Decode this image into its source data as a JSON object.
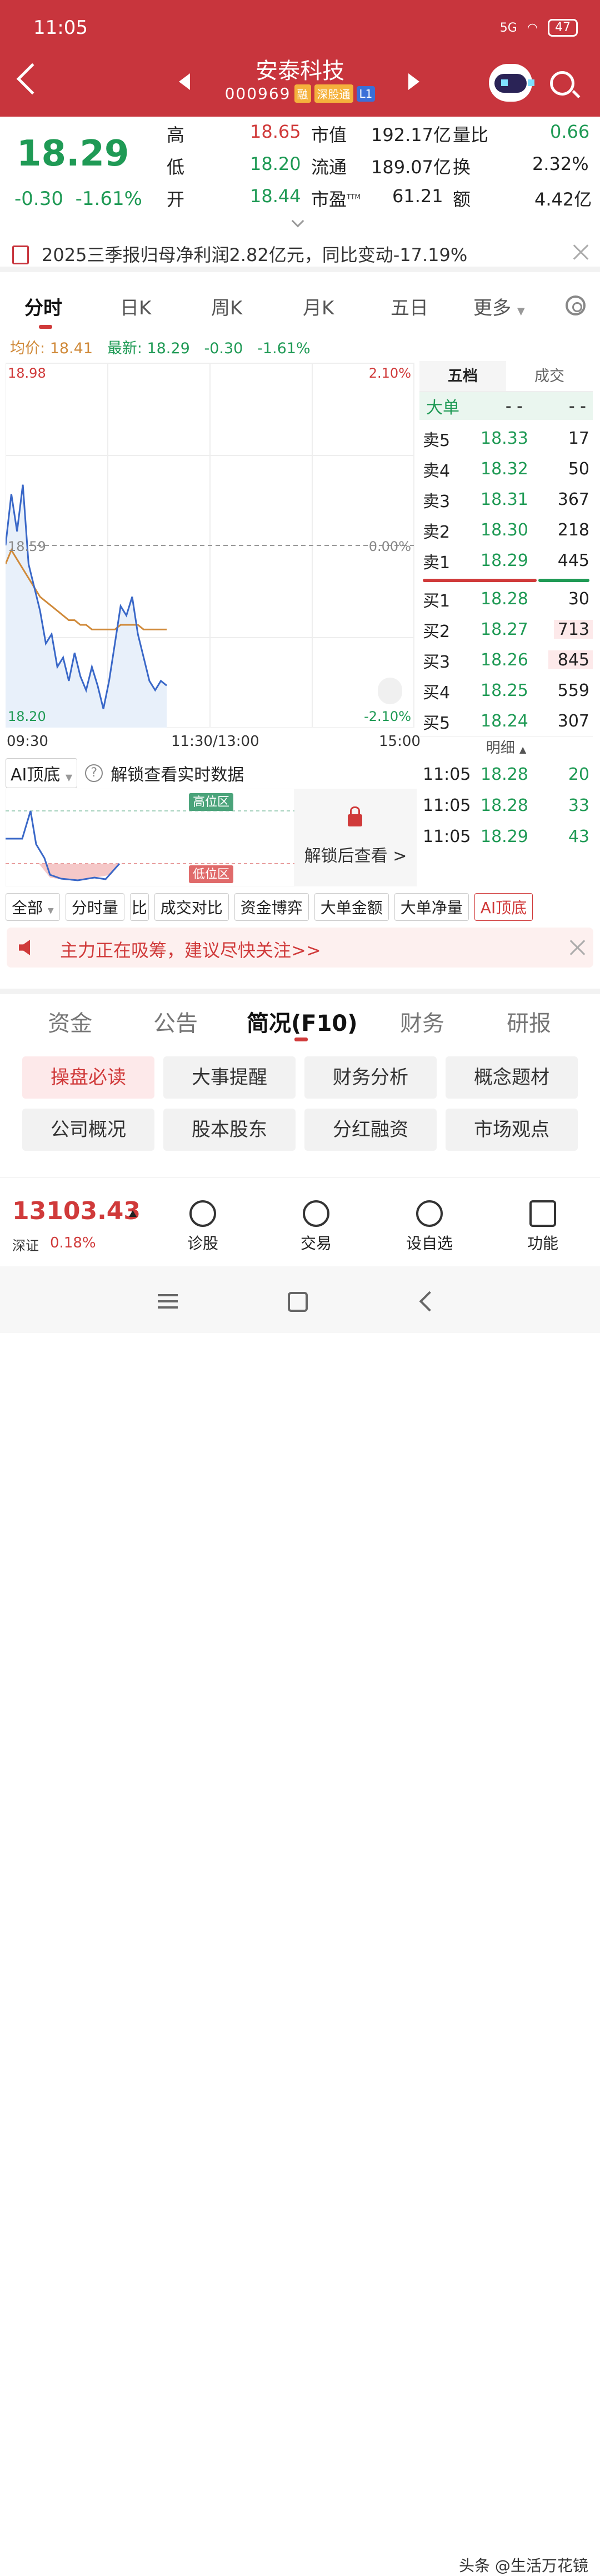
{
  "status": {
    "time": "11:05",
    "network": "5G",
    "battery": "47"
  },
  "header": {
    "name": "安泰科技",
    "code": "000969",
    "tags": [
      "融",
      "深股通",
      "L1"
    ]
  },
  "quote": {
    "price": "18.29",
    "change": "-0.30",
    "change_pct": "-1.61%",
    "high_label": "高",
    "high": "18.65",
    "low_label": "低",
    "low": "18.20",
    "open_label": "开",
    "open": "18.44",
    "mcap_label": "市值",
    "mcap": "192.17亿",
    "float_label": "流通",
    "float": "189.07亿",
    "pe_label": "市盈",
    "pe_sup": "TTM",
    "pe": "61.21",
    "vr_label": "量比",
    "vr": "0.66",
    "turn_label": "换",
    "turn": "2.32%",
    "amt_label": "额",
    "amt": "4.42亿"
  },
  "notice": {
    "text": "2025三季报归母净利润2.82亿元，同比变动-17.19%"
  },
  "chart_tabs": [
    "分时",
    "日K",
    "周K",
    "月K",
    "五日",
    "更多"
  ],
  "avg_line": {
    "avg_label": "均价:",
    "avg": "18.41",
    "latest_label": "最新:",
    "latest": "18.29",
    "chg": "-0.30",
    "pct": "-1.61%"
  },
  "chart_labels": {
    "top": "18.98",
    "mid": "18.59",
    "bottom": "18.20",
    "pct_top": "2.10%",
    "pct_mid": "0.00%",
    "pct_bottom": "-2.10%",
    "t_start": "09:30",
    "t_mid": "11:30/13:00",
    "t_end": "15:00"
  },
  "chart_data": {
    "type": "line",
    "ylim": [
      18.2,
      18.98
    ],
    "x_range": [
      "09:30",
      "15:00"
    ],
    "series": [
      {
        "values": [
          18.59,
          18.7,
          18.62,
          18.72,
          18.55,
          18.5,
          18.45,
          18.38,
          18.4,
          18.33,
          18.35,
          18.3,
          18.36,
          18.31,
          18.28,
          18.33,
          18.29,
          18.24,
          18.3,
          18.38,
          18.46,
          18.44,
          18.48,
          18.4,
          18.35,
          18.3,
          18.28,
          18.3,
          18.29
        ]
      },
      {
        "values": [
          18.55,
          18.58,
          18.56,
          18.54,
          18.52,
          18.5,
          18.48,
          18.47,
          18.46,
          18.45,
          18.44,
          18.43,
          18.43,
          18.42,
          18.42,
          18.41,
          18.41,
          18.41,
          18.41,
          18.41,
          18.42,
          18.42,
          18.42,
          18.42,
          18.41,
          18.41,
          18.41,
          18.41,
          18.41
        ]
      }
    ]
  },
  "order_book": {
    "tab_five": "五档",
    "tab_trade": "成交",
    "big_label": "大单",
    "big_a": "- -",
    "big_b": "- -",
    "sell": [
      {
        "label": "卖5",
        "price": "18.33",
        "vol": "17"
      },
      {
        "label": "卖4",
        "price": "18.32",
        "vol": "50"
      },
      {
        "label": "卖3",
        "price": "18.31",
        "vol": "367"
      },
      {
        "label": "卖2",
        "price": "18.30",
        "vol": "218"
      },
      {
        "label": "卖1",
        "price": "18.29",
        "vol": "445"
      }
    ],
    "buy": [
      {
        "label": "买1",
        "price": "18.28",
        "vol": "30"
      },
      {
        "label": "买2",
        "price": "18.27",
        "vol": "713"
      },
      {
        "label": "买3",
        "price": "18.26",
        "vol": "845"
      },
      {
        "label": "买4",
        "price": "18.25",
        "vol": "559"
      },
      {
        "label": "买5",
        "price": "18.24",
        "vol": "307"
      }
    ],
    "detail_label": "明细",
    "trades": [
      {
        "time": "11:05",
        "price": "18.28",
        "vol": "20"
      },
      {
        "time": "11:05",
        "price": "18.28",
        "vol": "33"
      },
      {
        "time": "11:05",
        "price": "18.29",
        "vol": "43"
      }
    ]
  },
  "ai": {
    "select": "AI顶底",
    "unlock": "解锁查看实时数据",
    "high_zone": "高位区",
    "low_zone": "低位区",
    "lock_text": "解锁后查看 >"
  },
  "chips": [
    "全部",
    "分时量",
    "比",
    "成交对比",
    "资金博弈",
    "大单金额",
    "大单净量",
    "AI顶底"
  ],
  "alert": {
    "text": "主力正在吸筹，建议尽快关注>>"
  },
  "info_tabs": [
    "资金",
    "公告",
    "简况(F10)",
    "财务",
    "研报"
  ],
  "grid_buttons": [
    "操盘必读",
    "大事提醒",
    "财务分析",
    "概念题材",
    "公司概况",
    "股本股东",
    "分红融资",
    "市场观点"
  ],
  "bottom": {
    "index_value": "13103.43",
    "index_name": "深证",
    "index_chg": "0.18%",
    "nav": [
      "诊股",
      "交易",
      "设自选",
      "功能"
    ]
  },
  "watermark": "头条 @生活万花镜",
  "colors": {
    "header": "#c8353d",
    "up": "#d03a3a",
    "down": "#1f9a55",
    "price_line": "#3a68c8",
    "avg_line": "#d08a3a"
  }
}
